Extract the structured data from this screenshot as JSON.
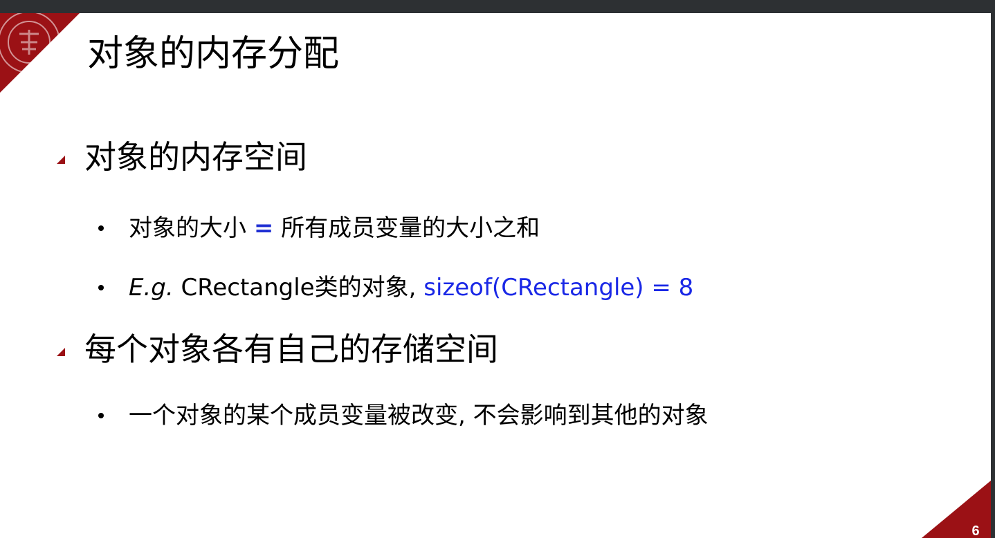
{
  "slide": {
    "title": "对象的内存分配",
    "page_number": "6",
    "accent_color": "#9b1115"
  },
  "bullets": [
    {
      "text": "对象的内存空间",
      "children": [
        {
          "prefix": "对象的大小 ",
          "operator": "=",
          "suffix": " 所有成员变量的大小之和"
        },
        {
          "italic": "E.g.",
          "plain": " CRectangle类的对象, ",
          "code": "sizeof(CRectangle) = 8"
        }
      ]
    },
    {
      "text": "每个对象各有自己的存储空间",
      "children": [
        {
          "text": "一个对象的某个成员变量被改变, 不会影响到其他的对象"
        }
      ]
    }
  ],
  "colors": {
    "top_bar": "#2d3033",
    "blue_text": "#1a28e6"
  },
  "icons": {
    "logo": "university-seal-icon",
    "level1_marker": "triangle-bullet-icon",
    "level2_marker": "dot-bullet-icon"
  }
}
